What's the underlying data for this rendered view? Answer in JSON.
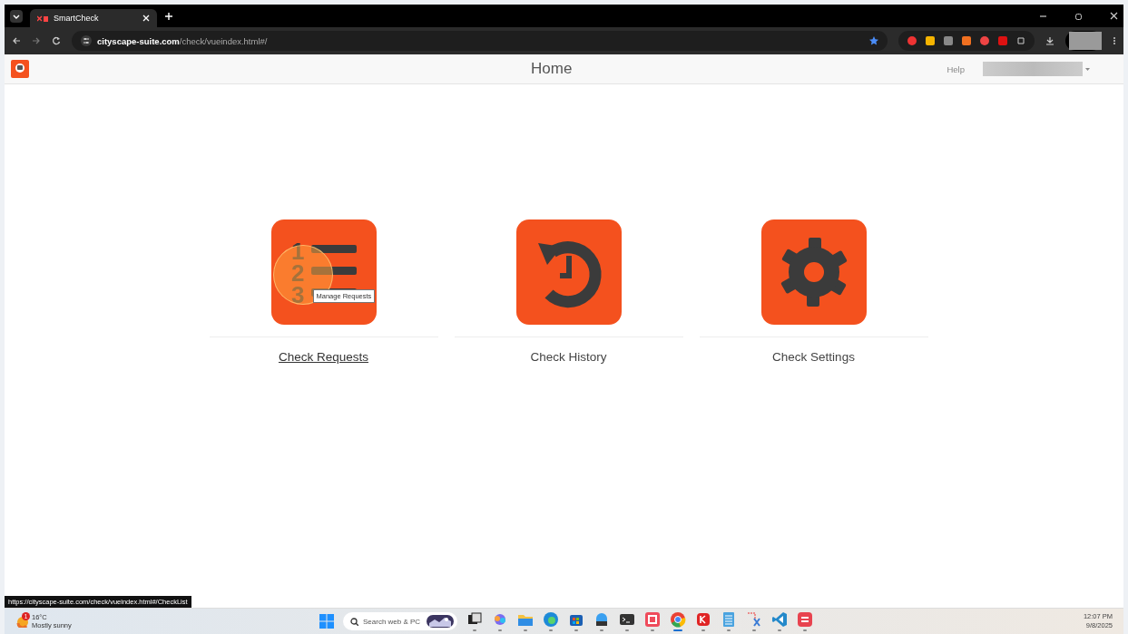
{
  "browser": {
    "tab_title": "SmartCheck",
    "url_host": "cityscape-suite.com",
    "url_path": "/check/vueindex.html#/"
  },
  "app_header": {
    "title": "Home",
    "help": "Help"
  },
  "tiles": [
    {
      "kind": "list",
      "label": "Check Requests",
      "hovered": true,
      "numbers": [
        "1",
        "2",
        "3"
      ],
      "tooltip": "Manage Requests"
    },
    {
      "kind": "history",
      "label": "Check History",
      "hovered": false
    },
    {
      "kind": "settings",
      "label": "Check Settings",
      "hovered": false
    }
  ],
  "status_url": "https://cityscape-suite.com/check/vueindex.html#/CheckList",
  "taskbar": {
    "weather": {
      "temp": "16°C",
      "condition": "Mostly sunny",
      "badge": "1"
    },
    "search_placeholder": "Search web & PC",
    "apps": [
      {
        "kind": "taskview",
        "active": false
      },
      {
        "kind": "copilot",
        "active": false
      },
      {
        "kind": "folder",
        "active": false
      },
      {
        "kind": "edge",
        "active": false
      },
      {
        "kind": "store",
        "active": false
      },
      {
        "kind": "photos",
        "active": false
      },
      {
        "kind": "terminal",
        "active": false
      },
      {
        "kind": "office",
        "active": false
      },
      {
        "kind": "chrome",
        "active": true
      },
      {
        "kind": "redk",
        "active": false
      },
      {
        "kind": "notepad",
        "active": false
      },
      {
        "kind": "snip",
        "active": false
      },
      {
        "kind": "vscode",
        "active": false
      },
      {
        "kind": "redapp",
        "active": false
      }
    ],
    "time": "12:07 PM",
    "date": "9/8/2025"
  }
}
